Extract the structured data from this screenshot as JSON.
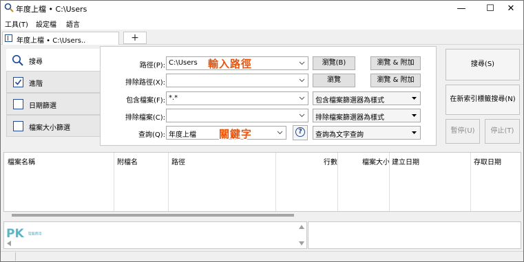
{
  "window": {
    "title": "年度上檔 • C:\\Users",
    "minimize": "—",
    "maximize": "☐",
    "close": "✕"
  },
  "menu": [
    "工具(T)",
    "設定檔",
    "語言"
  ],
  "tabs": [
    {
      "label": "年度上檔 • C:\\Users.."
    }
  ],
  "new_tab": "+",
  "left_panel": {
    "search_label": "搜尋",
    "items": [
      {
        "label": "進階",
        "checked": true
      },
      {
        "label": "日期篩選",
        "checked": false
      },
      {
        "label": "檔案大小篩選",
        "checked": false
      }
    ]
  },
  "form": {
    "path": {
      "label": "路徑(P):",
      "value": "C:\\Users",
      "browse": "瀏覽(B)",
      "browse_add": "瀏覽 & 附加"
    },
    "exclude_path": {
      "label": "排除路徑(X):",
      "value": "",
      "browse": "瀏覽",
      "browse_add": "瀏覽 & 附加"
    },
    "include_files": {
      "label": "包含檔案(F):",
      "value": "*.*",
      "filter_mode": "包含檔案篩選器為樣式"
    },
    "exclude_files": {
      "label": "排除檔案(C):",
      "value": "",
      "filter_mode": "排除檔案篩選器為樣式"
    },
    "query": {
      "label": "查詢(Q):",
      "value": "年度上檔",
      "help": "?",
      "mode": "查詢為文字查詢"
    }
  },
  "annotations": {
    "path_hint": "輸入路徑",
    "keyword_hint": "關鍵字"
  },
  "buttons": {
    "search": "搜尋(S)",
    "search_new_tab": "在新索引標籤搜尋(N)",
    "pause": "暫停(U)",
    "stop": "停止(T)"
  },
  "results": {
    "columns": [
      "檔案名稱",
      "附檔名",
      "路徑",
      "行數",
      "檔案大小",
      "建立日期",
      "存取日期"
    ]
  },
  "logo": {
    "text": "PK",
    "subtext": "電腦應用"
  },
  "colors": {
    "accent": "#1e4a96",
    "overlay": "#e8540c"
  }
}
